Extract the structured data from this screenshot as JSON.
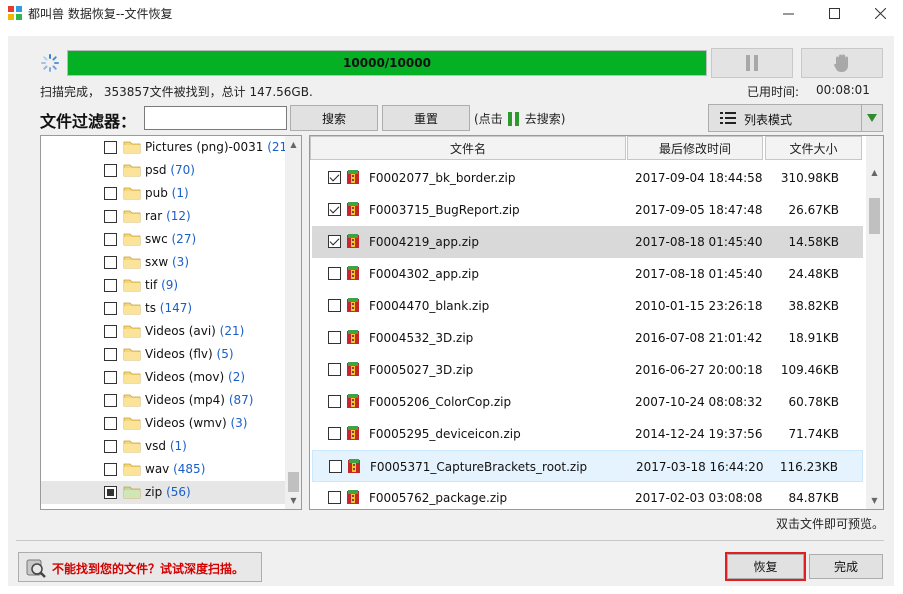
{
  "window": {
    "title": "都叫兽 数据恢复--文件恢复",
    "minimize_glyph": "—",
    "maximize_glyph": "☐",
    "close_glyph": "✕"
  },
  "scan": {
    "progress_text": "10000/10000",
    "progress_fraction": 1.0,
    "status_text": "扫描完成， 353857文件被找到，总计 147.56GB.",
    "time_label": "已用时间:",
    "time_value": "00:08:01"
  },
  "filter": {
    "label": "文件过滤器：",
    "input_value": "",
    "search_label": "搜索",
    "reset_label": "重置",
    "hint_prefix": "(点击",
    "hint_suffix": "去搜索)"
  },
  "view": {
    "mode_label": "列表模式"
  },
  "tree": {
    "items": [
      {
        "name": "Pictures (png)-0031",
        "count": "(21)",
        "checked": false
      },
      {
        "name": "psd",
        "count": "(70)",
        "checked": false
      },
      {
        "name": "pub",
        "count": "(1)",
        "checked": false
      },
      {
        "name": "rar",
        "count": "(12)",
        "checked": false
      },
      {
        "name": "swc",
        "count": "(27)",
        "checked": false
      },
      {
        "name": "sxw",
        "count": "(3)",
        "checked": false
      },
      {
        "name": "tif",
        "count": "(9)",
        "checked": false
      },
      {
        "name": "ts",
        "count": "(147)",
        "checked": false
      },
      {
        "name": "Videos (avi)",
        "count": "(21)",
        "checked": false
      },
      {
        "name": "Videos (flv)",
        "count": "(5)",
        "checked": false
      },
      {
        "name": "Videos (mov)",
        "count": "(2)",
        "checked": false
      },
      {
        "name": "Videos (mp4)",
        "count": "(87)",
        "checked": false
      },
      {
        "name": "Videos (wmv)",
        "count": "(3)",
        "checked": false
      },
      {
        "name": "vsd",
        "count": "(1)",
        "checked": false
      },
      {
        "name": "wav",
        "count": "(485)",
        "checked": false
      },
      {
        "name": "zip",
        "count": "(56)",
        "checked": true
      }
    ]
  },
  "files": {
    "headers": {
      "name": "文件名",
      "modified": "最后修改时间",
      "size": "文件大小"
    },
    "rows": [
      {
        "name": "F0002077_bk_border.zip",
        "modified": "2017-09-04 18:44:58",
        "size": "310.98KB",
        "checked": true,
        "state": ""
      },
      {
        "name": "F0003715_BugReport.zip",
        "modified": "2017-09-05 18:47:48",
        "size": "26.67KB",
        "checked": true,
        "state": ""
      },
      {
        "name": "F0004219_app.zip",
        "modified": "2017-08-18 01:45:40",
        "size": "14.58KB",
        "checked": true,
        "state": "sel"
      },
      {
        "name": "F0004302_app.zip",
        "modified": "2017-08-18 01:45:40",
        "size": "24.48KB",
        "checked": false,
        "state": ""
      },
      {
        "name": "F0004470_blank.zip",
        "modified": "2010-01-15 23:26:18",
        "size": "38.82KB",
        "checked": false,
        "state": ""
      },
      {
        "name": "F0004532_3D.zip",
        "modified": "2016-07-08 21:01:42",
        "size": "18.91KB",
        "checked": false,
        "state": ""
      },
      {
        "name": "F0005027_3D.zip",
        "modified": "2016-06-27 20:00:18",
        "size": "109.46KB",
        "checked": false,
        "state": ""
      },
      {
        "name": "F0005206_ColorCop.zip",
        "modified": "2007-10-24 08:08:32",
        "size": "60.78KB",
        "checked": false,
        "state": ""
      },
      {
        "name": "F0005295_deviceicon.zip",
        "modified": "2014-12-24 19:37:56",
        "size": "71.74KB",
        "checked": false,
        "state": ""
      },
      {
        "name": "F0005371_CaptureBrackets_root.zip",
        "modified": "2017-03-18 16:44:20",
        "size": "116.23KB",
        "checked": false,
        "state": "hover"
      },
      {
        "name": "F0005762_package.zip",
        "modified": "2017-02-03 03:08:08",
        "size": "84.87KB",
        "checked": false,
        "state": ""
      }
    ]
  },
  "footer": {
    "preview_hint": "双击文件即可预览。",
    "deep_scan_text": "不能找到您的文件？试试深度扫描。",
    "recover_label": "恢复",
    "finish_label": "完成"
  },
  "colors": {
    "progress_green": "#06b025",
    "count_blue": "#1a5fc9",
    "warning_red": "#d40000"
  }
}
